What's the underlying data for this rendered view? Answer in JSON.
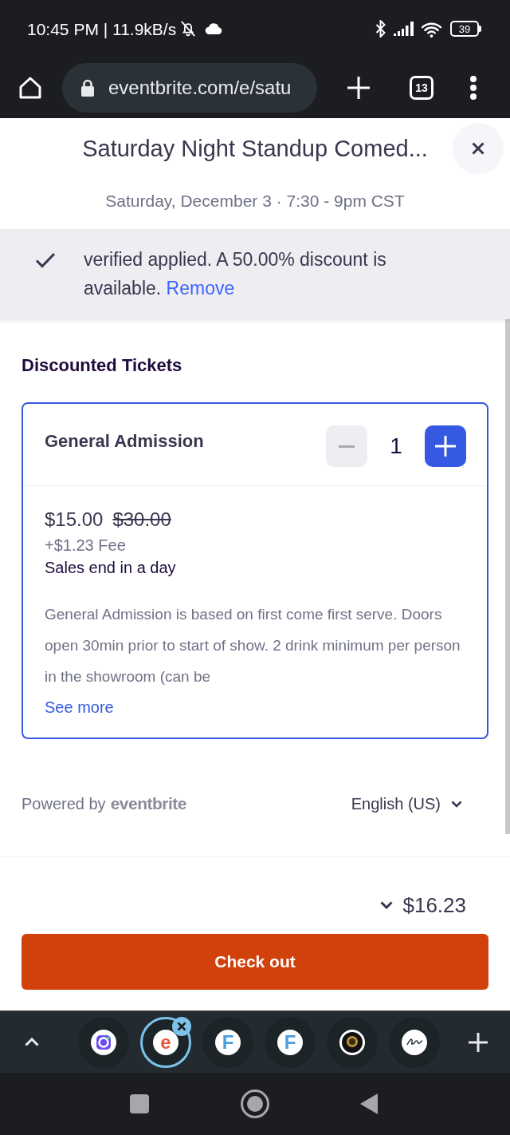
{
  "status_bar": {
    "time_and_speed": "10:45 PM | 11.9kB/s",
    "battery": "39"
  },
  "browser": {
    "url": "eventbrite.com/e/satu",
    "tab_count": "13"
  },
  "modal": {
    "title": "Saturday Night Standup Comed...",
    "date": "Saturday, December 3 · 7:30 - 9pm CST"
  },
  "discount_banner": {
    "message": "verified applied. A 50.00% discount is available.",
    "link": "Remove"
  },
  "section_title": "Discounted Tickets",
  "tickets": [
    {
      "name": "General Admission",
      "quantity": "1",
      "decrement_disabled": true,
      "increment_disabled": false,
      "price": "$15.00",
      "original_price": "$30.00",
      "fee": "+$1.23 Fee",
      "sales_end": "Sales end in a day",
      "description": "General Admission is based on first come first serve. Doors open 30min prior to start of show. 2 drink minimum per person in the showroom (can be",
      "more_link": "See more"
    }
  ],
  "footer": {
    "powered_by": "Powered by",
    "brand": "eventbrite",
    "language": "English (US)"
  },
  "order": {
    "total": "$16.23",
    "checkout": "Check out"
  },
  "browser_tabs": [
    {
      "kind": "ring",
      "selected": false
    },
    {
      "kind": "letter",
      "letter": "e",
      "color": "#e8553a",
      "selected": true
    },
    {
      "kind": "letter",
      "letter": "F",
      "color": "#4a9fdc",
      "selected": false
    },
    {
      "kind": "letter",
      "letter": "F",
      "color": "#4a9fdc",
      "selected": false
    },
    {
      "kind": "emblem",
      "selected": false
    },
    {
      "kind": "signature",
      "selected": false
    }
  ]
}
